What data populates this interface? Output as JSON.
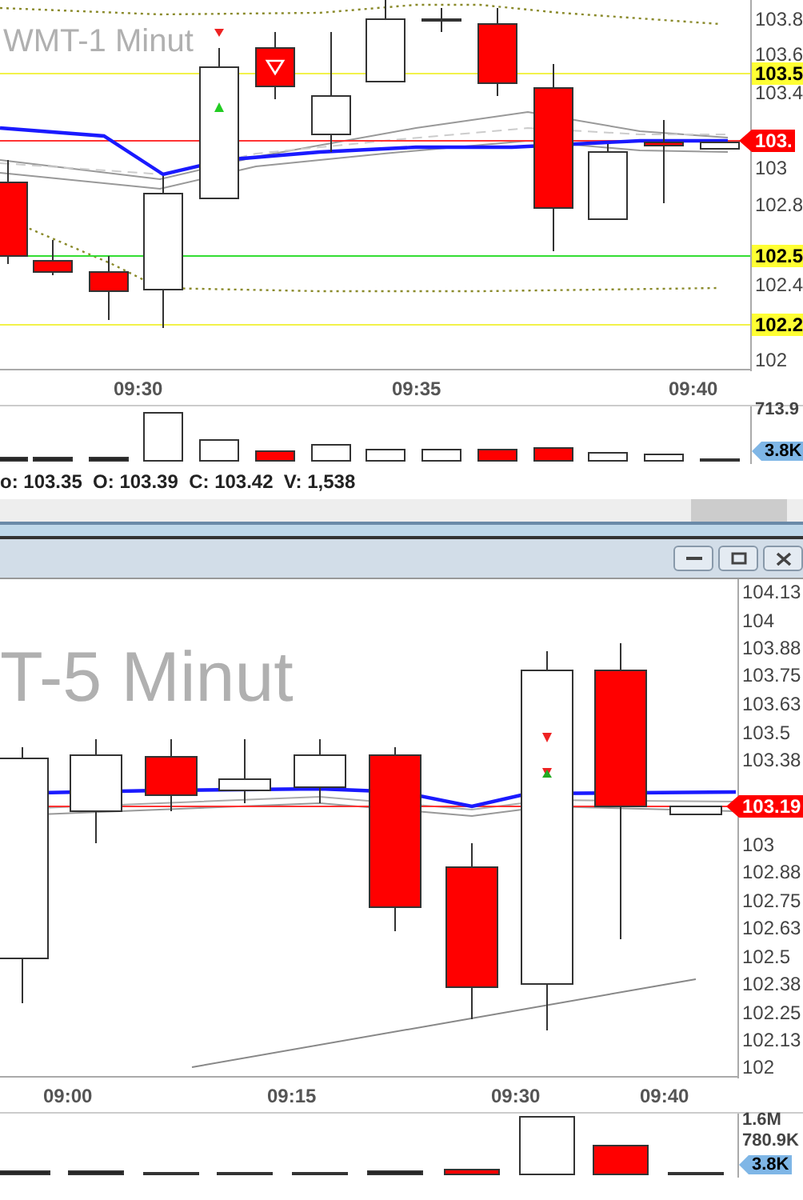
{
  "top_chart": {
    "watermark": "WMT-1 Minut",
    "price_axis": [
      "103.8",
      "103.6",
      "103.4",
      "103",
      "102.8",
      "102.4",
      "102"
    ],
    "price_tags": [
      {
        "text": "103.5",
        "kind": "level"
      },
      {
        "text": "103.",
        "kind": "last"
      },
      {
        "text": "102.5",
        "kind": "level"
      },
      {
        "text": "102.2",
        "kind": "level"
      }
    ],
    "time_axis": [
      "09:30",
      "09:35",
      "09:40"
    ],
    "volume_axis": [
      "713.9"
    ],
    "volume_tag": "3.8K"
  },
  "status_bar": {
    "text": "o: 103.35  O: 103.39  C: 103.42  V: 1,538"
  },
  "bottom_window": {
    "watermark": "T-5 Minut",
    "price_axis": [
      "104.13",
      "104",
      "103.88",
      "103.75",
      "103.63",
      "103.5",
      "103.38",
      "103",
      "102.88",
      "102.75",
      "102.63",
      "102.5",
      "102.38",
      "102.25",
      "102.13",
      "102"
    ],
    "price_tags": [
      {
        "text": "103.19",
        "kind": "last"
      }
    ],
    "time_axis": [
      "09:00",
      "09:15",
      "09:30",
      "09:40"
    ],
    "volume_axis": [
      "1.6M",
      "780.9K"
    ],
    "volume_tag": "3.8K"
  }
}
